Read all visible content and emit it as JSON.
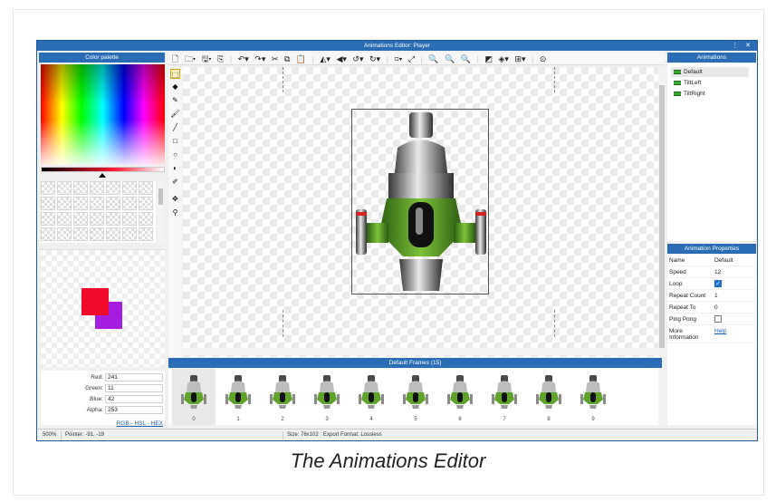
{
  "window": {
    "title": "Animations Editor: Player",
    "controls": "⋮ ✕"
  },
  "palette": {
    "header": "Color palette",
    "primary_color": "#f10b2a",
    "secondary_color": "#a51ee0",
    "fields": [
      {
        "label": "Red:",
        "value": "241"
      },
      {
        "label": "Green:",
        "value": "11"
      },
      {
        "label": "Blue:",
        "value": "42"
      },
      {
        "label": "Alpha:",
        "value": "253"
      }
    ],
    "modes": [
      "RGB",
      "HSL",
      "HEX"
    ],
    "mode_separator": " - "
  },
  "toolbar": {
    "icons": [
      "new-file-icon",
      "open-icon",
      "save-icon",
      "export-icon",
      "undo-icon",
      "redo-icon",
      "cut-icon",
      "copy-icon",
      "paste-icon",
      "flip-icon",
      "mirror-icon",
      "rotate-left-icon",
      "rotate-right-icon",
      "crop-icon",
      "resize-icon",
      "zoom-in-icon",
      "zoom-out-icon",
      "zoom-fit-icon",
      "background-icon",
      "layers-icon",
      "grid-icon",
      "target-icon"
    ]
  },
  "tools": [
    "rectangle-select-icon",
    "eraser-icon",
    "pencil-icon",
    "brush-icon",
    "line-icon",
    "rectangle-icon",
    "ellipse-icon",
    "fill-bucket-icon",
    "eyedropper-icon",
    "move-icon",
    "transform-icon"
  ],
  "frames": {
    "header": "Default Frames (15)",
    "items": [
      "0",
      "1",
      "2",
      "3",
      "4",
      "5",
      "6",
      "7",
      "8",
      "9"
    ],
    "selected": 0
  },
  "animations": {
    "header": "Animations",
    "items": [
      "Default",
      "TiltLeft",
      "TiltRight"
    ],
    "selected": 0
  },
  "properties": {
    "header": "Animation Properties",
    "name_label": "Name",
    "name_value": "Default",
    "speed_label": "Speed",
    "speed_value": "12",
    "loop_label": "Loop",
    "loop_checked": true,
    "repeat_count_label": "Repeat Count",
    "repeat_count_value": "1",
    "repeat_to_label": "Repeat To",
    "repeat_to_value": "0",
    "ping_pong_label": "Ping Pong",
    "ping_pong_checked": false,
    "more_info_label": "More Information",
    "more_info_link": "Help"
  },
  "status": {
    "zoom": "500%",
    "pointer": "Pointer: -91, -19",
    "size": "Size: 76x102",
    "export_format": "Export Format: Lossless"
  },
  "caption": "The Animations Editor",
  "colors": {
    "accent": "#2a6db5",
    "link": "#1b5fb6",
    "ship_green": "#5fa32b"
  }
}
